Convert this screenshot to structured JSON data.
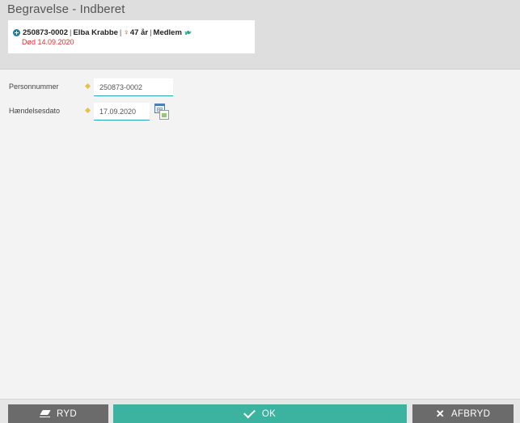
{
  "header": {
    "title": "Begravelse - Indberet"
  },
  "person": {
    "cpr": "250873-0002",
    "name": "Elba Krabbe",
    "age": "47 år",
    "membership": "Medlem",
    "separator": "|",
    "death_line": "Død 14.09.2020"
  },
  "form": {
    "personnummer_label": "Personnummer",
    "personnummer_value": "250873-0002",
    "haendelsesdato_label": "Hændelsesdato",
    "haendelsesdato_value": "17.09.2020"
  },
  "footer": {
    "ryd_label": "RYD",
    "ok_label": "OK",
    "afbryd_label": "AFBRYD"
  },
  "colors": {
    "ok_button": "#3cb3a0",
    "secondary_button": "#6b6b6b",
    "death_text": "#e03030",
    "required_marker": "#e8c04a",
    "input_underline": "#29a6b6"
  },
  "icons": {
    "expand": "plus-circle-icon",
    "gender": "female-icon",
    "membership": "leaf-icon",
    "required": "required-diamond-icon",
    "calendar": "calendar-icon",
    "ryd": "eraser-icon",
    "ok": "check-icon",
    "afbryd": "close-icon"
  }
}
